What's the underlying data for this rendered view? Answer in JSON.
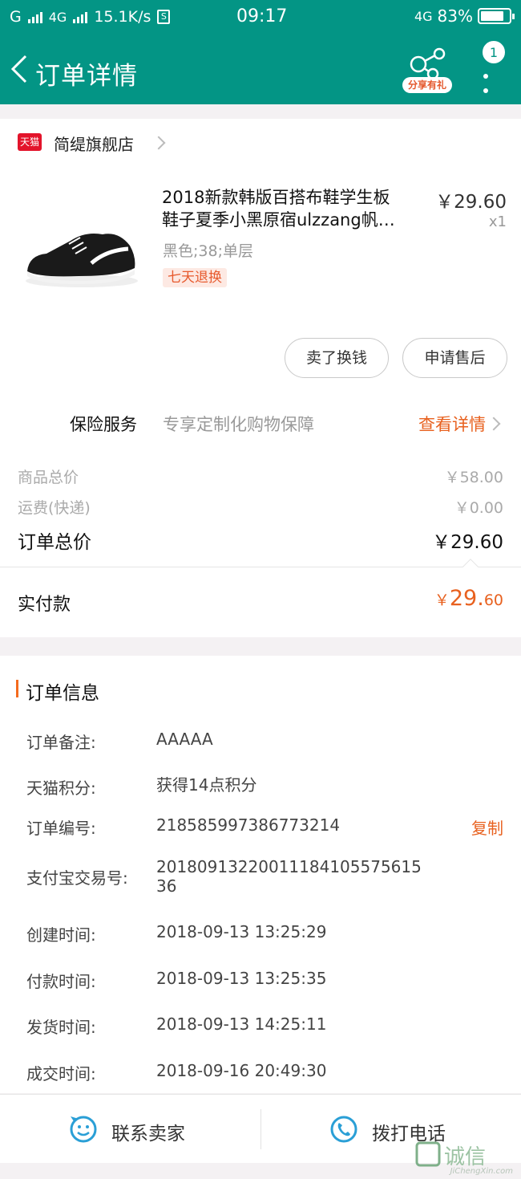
{
  "status_bar": {
    "carrier": "G",
    "network": "4G",
    "speed": "15.1K/s",
    "time": "09:17",
    "network_right": "4G",
    "battery": "83%",
    "battery_level": 0.83
  },
  "header": {
    "title": "订单详情",
    "share_label": "分享有礼",
    "badge": "1"
  },
  "store": {
    "badge": "天猫",
    "name": "简缇旗舰店"
  },
  "product": {
    "title_line1": "2018新款韩版百搭布鞋学生板",
    "title_line2": "鞋子夏季小黑原宿ulzzang帆…",
    "price": "￥29.60",
    "qty": "x1",
    "sku": "黑色;38;单层",
    "tag": "七天退换"
  },
  "actions": {
    "sell": "卖了换钱",
    "aftersale": "申请售后"
  },
  "insurance": {
    "label": "保险服务",
    "desc": "专享定制化购物保障",
    "link": "查看详情"
  },
  "summary": {
    "goods_label": "商品总价",
    "goods_value": "￥58.00",
    "shipping_label": "运费(快递)",
    "shipping_value": "￥0.00",
    "order_total_label": "订单总价",
    "order_total_value": "￥29.60",
    "paid_label": "实付款",
    "paid_currency": "￥",
    "paid_int": "29.",
    "paid_dec": "60"
  },
  "order_info": {
    "title": "订单信息",
    "rows": [
      {
        "k": "订单备注:",
        "v": "AAAAA"
      },
      {
        "k": "天猫积分:",
        "v": "获得14点积分"
      },
      {
        "k": "订单编号:",
        "v": "218585997386773214",
        "action": "复制"
      },
      {
        "k": "支付宝交易号:",
        "v": "2018091322001118410557561536"
      },
      {
        "k": "创建时间:",
        "v": "2018-09-13 13:25:29"
      },
      {
        "k": "付款时间:",
        "v": "2018-09-13 13:25:35"
      },
      {
        "k": "发货时间:",
        "v": "2018-09-13 14:25:11"
      },
      {
        "k": "成交时间:",
        "v": "2018-09-16 20:49:30"
      }
    ]
  },
  "bottom": {
    "contact": "联系卖家",
    "call": "拨打电话"
  },
  "watermark": {
    "text": "JiChengXin.com"
  },
  "colors": {
    "header": "#039585",
    "accent": "#e8611f",
    "tmall": "#e3142b",
    "icon_blue": "#2a9fd6"
  }
}
